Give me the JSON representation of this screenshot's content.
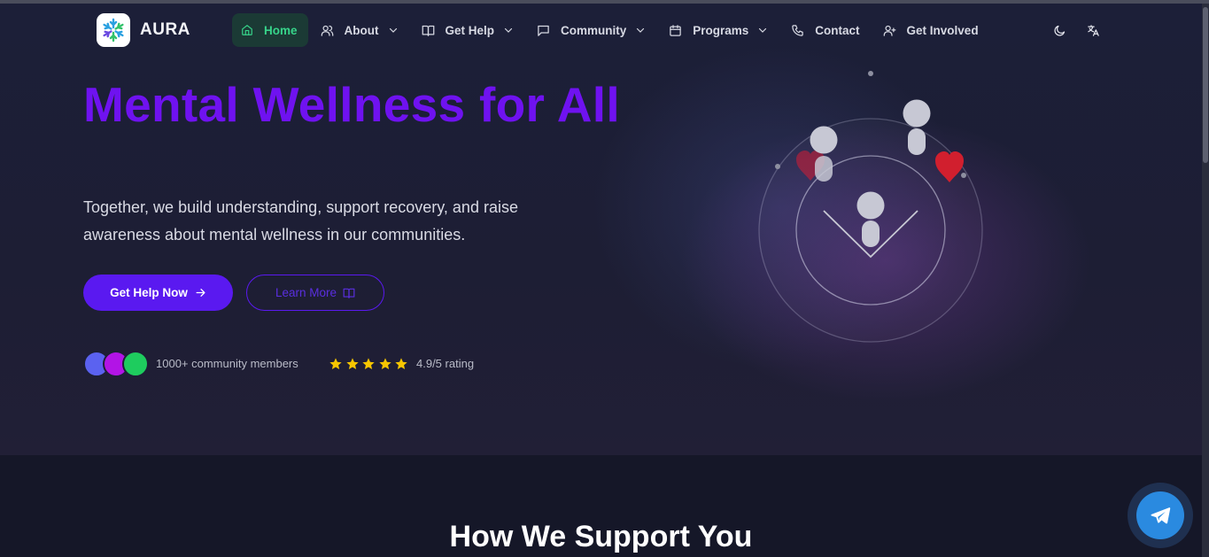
{
  "brand": {
    "name": "AURA"
  },
  "nav": {
    "items": [
      {
        "label": "Home",
        "icon": "home-icon",
        "active": true,
        "dropdown": false
      },
      {
        "label": "About",
        "icon": "users-icon",
        "active": false,
        "dropdown": true
      },
      {
        "label": "Get Help",
        "icon": "book-icon",
        "active": false,
        "dropdown": true
      },
      {
        "label": "Community",
        "icon": "message-icon",
        "active": false,
        "dropdown": true
      },
      {
        "label": "Programs",
        "icon": "calendar-icon",
        "active": false,
        "dropdown": true
      },
      {
        "label": "Contact",
        "icon": "phone-icon",
        "active": false,
        "dropdown": false
      },
      {
        "label": "Get Involved",
        "icon": "user-plus-icon",
        "active": false,
        "dropdown": false
      }
    ],
    "tools": [
      {
        "icon": "moon-icon"
      },
      {
        "icon": "translate-icon"
      }
    ]
  },
  "hero": {
    "title": "Mental Wellness for All",
    "subtitle": "Together, we build understanding, support recovery, and raise awareness about mental wellness in our communities.",
    "primary_button": "Get Help Now",
    "secondary_button": "Learn More",
    "members_text": "1000+ community members",
    "rating_text": "4.9/5 rating",
    "stars": 5
  },
  "support_section": {
    "title": "How We Support You"
  },
  "colors": {
    "accent": "#5a19f0",
    "title": "#6f12f0",
    "active_nav_bg": "#1b3a35",
    "active_nav_text": "#37d48a",
    "star": "#f7c600",
    "avatars": [
      "#5b62f0",
      "#b214e6",
      "#1ecc5e"
    ],
    "telegram": "#2a8ae0"
  },
  "floating": {
    "icon": "telegram-icon"
  }
}
